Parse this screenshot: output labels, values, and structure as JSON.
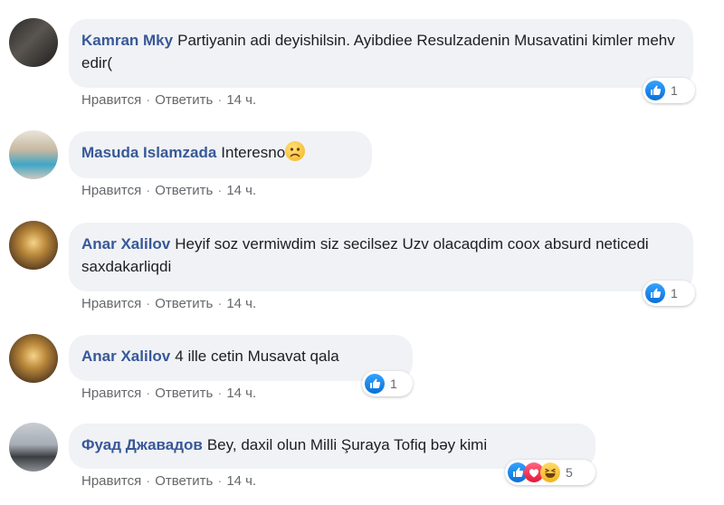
{
  "actions": {
    "like": "Нравится",
    "reply": "Ответить",
    "separator": "·"
  },
  "comments": [
    {
      "author": "Kamran Mky",
      "text": "Partiyanin adi deyishilsin. Ayibdiee Resulzadenin Musavatini kimler mehv edir(",
      "time": "14 ч.",
      "reaction_count": "1"
    },
    {
      "author": "Masuda Islamzada",
      "text": "Interesno",
      "time": "14 ч.",
      "reaction_count": ""
    },
    {
      "author": "Anar Xalilov",
      "text": "Heyif soz vermiwdim siz secilsez Uzv olacaqdim coox absurd neticedi saxdakarliqdi",
      "time": "14 ч.",
      "reaction_count": "1"
    },
    {
      "author": "Anar Xalilov",
      "text": "4 ille cetin Musavat qala",
      "time": "14 ч.",
      "reaction_count": "1"
    },
    {
      "author": "Фуад Джавадов",
      "text": "Bey, daxil olun Milli Şuraya Tofiq bəy kimi",
      "time": "14 ч.",
      "reaction_count": "5"
    }
  ],
  "icons": [
    "like-icon",
    "love-icon",
    "haha-icon",
    "sad-emoji-icon"
  ],
  "colors": {
    "author": "#385898",
    "bubble": "#f0f2f5",
    "meta": "#65676b",
    "like": "#1877f2"
  }
}
